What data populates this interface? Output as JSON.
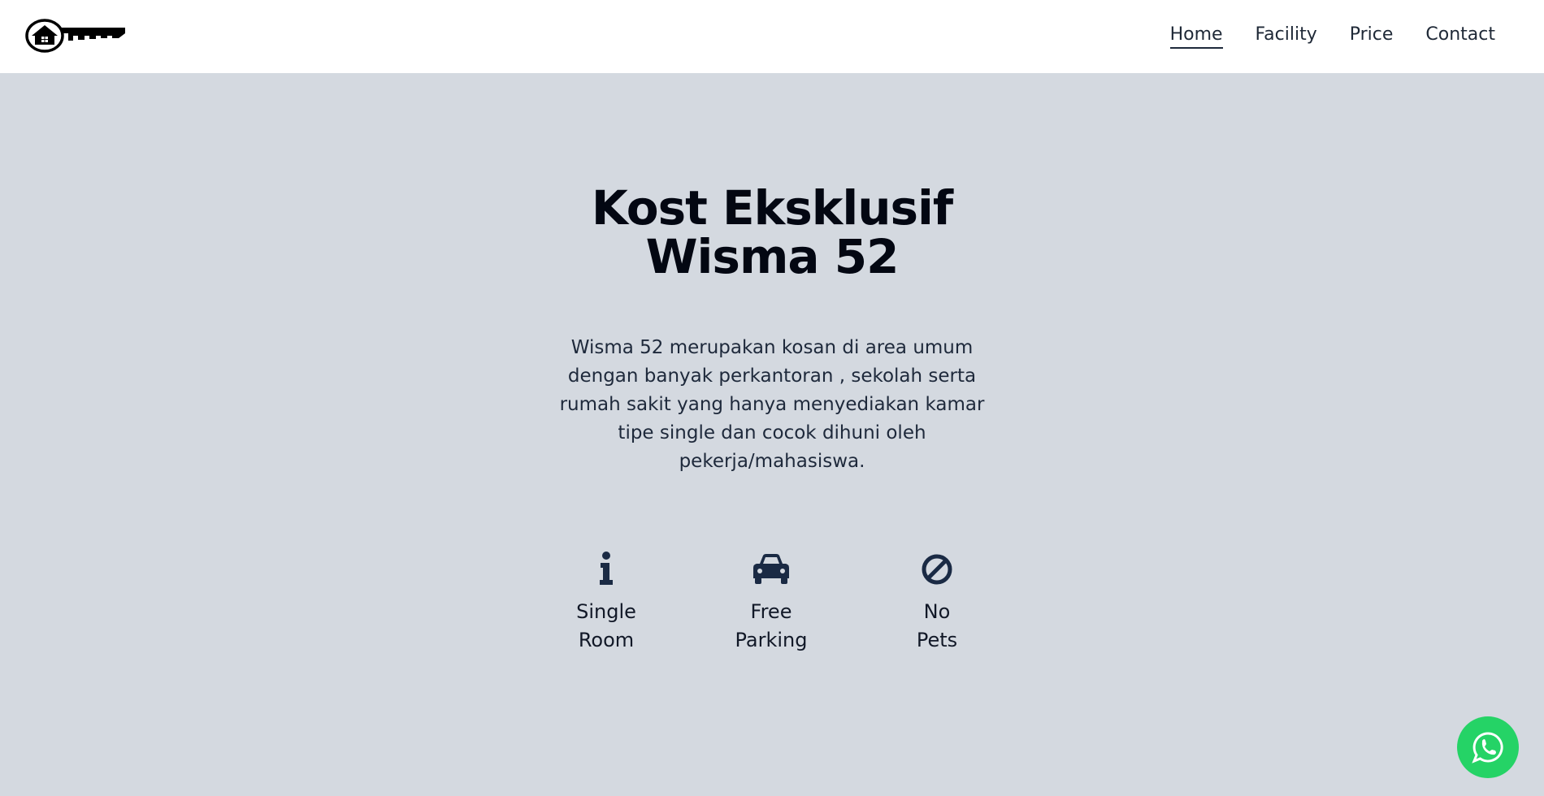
{
  "nav": {
    "logo_icon": "house-key-logo",
    "links": [
      {
        "label": "Home",
        "active": true
      },
      {
        "label": "Facility",
        "active": false
      },
      {
        "label": "Price",
        "active": false
      },
      {
        "label": "Contact",
        "active": false
      }
    ]
  },
  "hero": {
    "title_line1": "Kost Eksklusif",
    "title_line2": "Wisma 52",
    "description": "Wisma 52 merupakan kosan di area umum dengan banyak perkantoran , sekolah serta rumah sakit yang hanya menyediakan kamar tipe single dan cocok dihuni oleh pekerja/mahasiswa."
  },
  "features": [
    {
      "icon": "info-icon",
      "line1": "Single",
      "line2": "Room"
    },
    {
      "icon": "car-icon",
      "line1": "Free",
      "line2": "Parking"
    },
    {
      "icon": "ban-icon",
      "line1": "No",
      "line2": "Pets"
    }
  ],
  "whatsapp": {
    "icon": "whatsapp-icon"
  },
  "colors": {
    "background": "#d4d9e0",
    "navbar": "#ffffff",
    "text_dark": "#030712",
    "icon_navy": "#1a2a44",
    "whatsapp_green": "#25d366"
  }
}
